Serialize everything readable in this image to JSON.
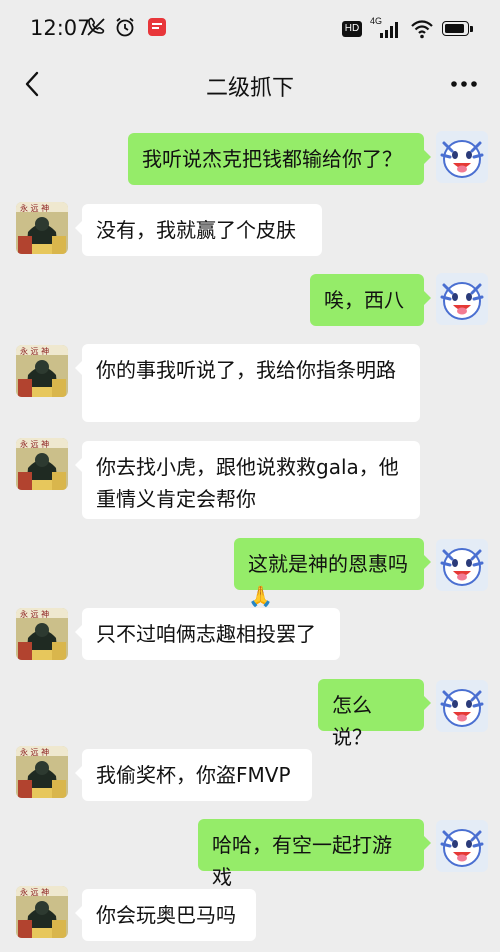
{
  "status_bar": {
    "time": "12:07",
    "network_label": "4G",
    "hd_label": "HD",
    "battery_level": 0.9
  },
  "nav": {
    "title": "二级抓下"
  },
  "colors": {
    "background": "#ededed",
    "sent_bubble": "#95ec69",
    "received_bubble": "#ffffff"
  },
  "messages": [
    {
      "side": "right",
      "text": "我听说杰克把钱都输给你了？"
    },
    {
      "side": "left",
      "text": "没有，我就赢了个皮肤"
    },
    {
      "side": "right",
      "text": "唉，西八"
    },
    {
      "side": "left",
      "text": "你的事我听说了，我给你指条明路"
    },
    {
      "side": "left",
      "text": "你去找小虎，跟他说救救gala，他重情义肯定会帮你"
    },
    {
      "side": "right",
      "text": "这就是神的恩惠吗🙏"
    },
    {
      "side": "left",
      "text": "只不过咱俩志趣相投罢了"
    },
    {
      "side": "right",
      "text": "怎么说？"
    },
    {
      "side": "left",
      "text": "我偷奖杯，你盗FMVP"
    },
    {
      "side": "right",
      "text": "哈哈，有空一起打游戏"
    },
    {
      "side": "left",
      "text": "你会玩奥巴马吗"
    }
  ]
}
